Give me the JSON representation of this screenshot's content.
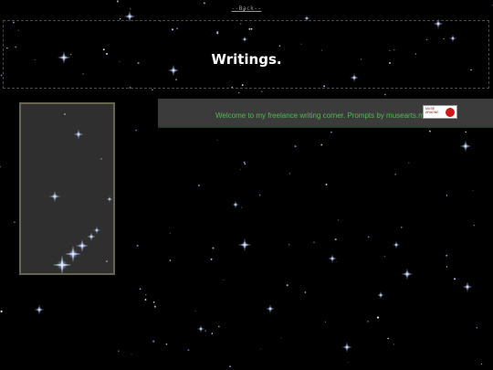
{
  "nav": {
    "back_label": "--Back--"
  },
  "header": {
    "title": "Writings."
  },
  "welcome": {
    "message": "Welcome to my freelance writing corner. Prompts by musearts.me."
  },
  "badge": {
    "line1": "MUSE",
    "line2": "ARADNE"
  },
  "colors": {
    "background": "#000000",
    "title": "#ffffff",
    "welcome_text": "#58b558",
    "panel": "#2f2f2f",
    "panel_border": "#666650",
    "bar": "#3b3b3b",
    "badge_accent": "#cc1a1a"
  },
  "icons": {
    "background": "starfield",
    "badge": "muse-badge-icon"
  }
}
